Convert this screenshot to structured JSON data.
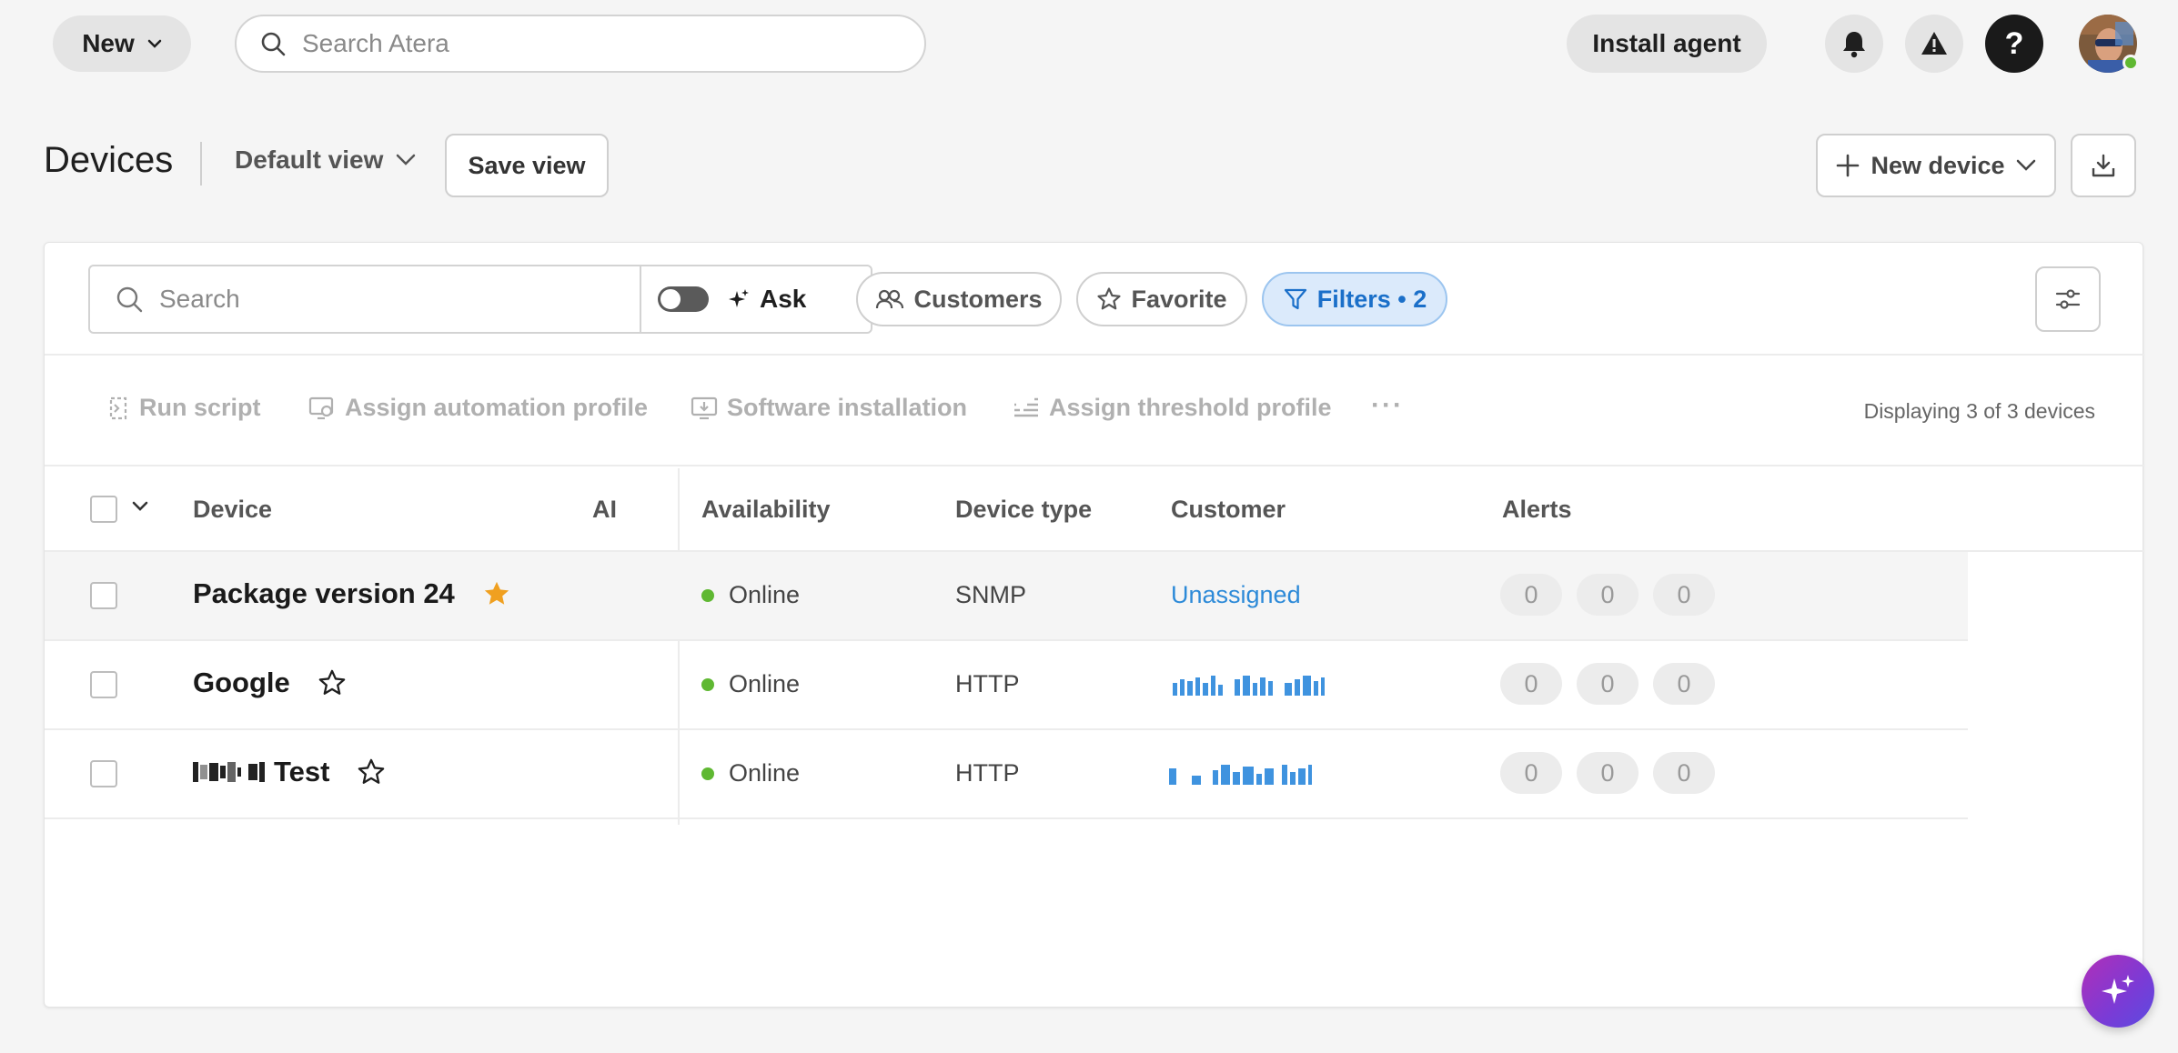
{
  "topbar": {
    "new_label": "New",
    "search_placeholder": "Search Atera",
    "install_label": "Install agent",
    "help_label": "?"
  },
  "header": {
    "title": "Devices",
    "view_label": "Default view",
    "save_view_label": "Save view",
    "new_device_label": "New device"
  },
  "filters": {
    "search_placeholder": "Search",
    "ask_label": "Ask",
    "customers_label": "Customers",
    "favorite_label": "Favorite",
    "filters_label": "Filters • 2"
  },
  "actions": {
    "run_script": "Run script",
    "assign_automation": "Assign automation profile",
    "software_installation": "Software installation",
    "assign_threshold": "Assign threshold profile",
    "more": "···",
    "displaying": "Displaying 3 of 3 devices"
  },
  "table": {
    "columns": {
      "device": "Device",
      "ai": "AI",
      "availability": "Availability",
      "device_type": "Device type",
      "customer": "Customer",
      "alerts": "Alerts"
    },
    "rows": [
      {
        "name": "Package version 24",
        "favorite": true,
        "availability": "Online",
        "type": "SNMP",
        "customer": "Unassigned",
        "alerts": [
          "0",
          "0",
          "0"
        ]
      },
      {
        "name": "Google",
        "favorite": false,
        "availability": "Online",
        "type": "HTTP",
        "customer": "",
        "alerts": [
          "0",
          "0",
          "0"
        ]
      },
      {
        "name": "Test",
        "favorite": false,
        "availability": "Online",
        "type": "HTTP",
        "customer": "",
        "alerts": [
          "0",
          "0",
          "0"
        ]
      }
    ]
  },
  "colors": {
    "accent_blue": "#2d8ad8",
    "online_green": "#5fb832",
    "favorite_orange": "#f0a020",
    "filter_chip_bg": "#dbeafb"
  },
  "icons": {
    "new": "chevron-down-icon",
    "search": "search-icon",
    "bell": "bell-icon",
    "warning": "warning-icon",
    "help": "help-icon",
    "export": "download-icon",
    "ai": "sparkle-icon"
  }
}
